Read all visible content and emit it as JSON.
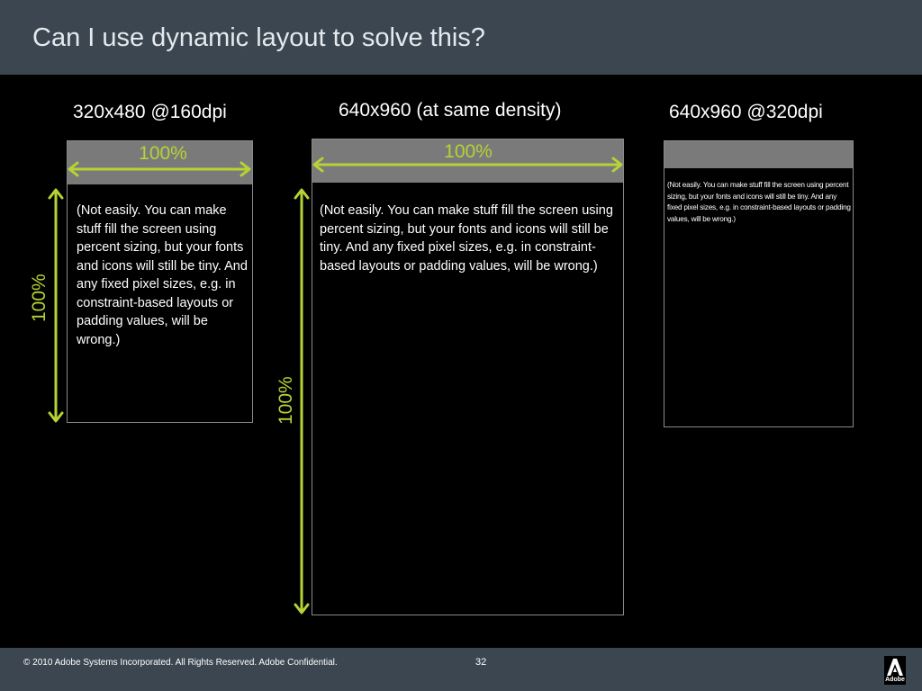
{
  "slide": {
    "title": "Can I use dynamic layout to solve this?",
    "page_number": "32",
    "footer": "© 2010 Adobe Systems Incorporated.  All Rights Reserved.  Adobe Confidential.",
    "logo_text": "Adobe"
  },
  "columns": [
    {
      "label": "320x480 @160dpi",
      "width_label": "100%",
      "height_label": "100%",
      "body": "(Not easily. You can make stuff fill the screen using percent sizing, but your fonts and icons will still be tiny. And any fixed pixel sizes, e.g. in constraint-based layouts or padding values, will be wrong.)"
    },
    {
      "label": "640x960 (at same density)",
      "width_label": "100%",
      "height_label": "100%",
      "body": "(Not easily. You can make stuff fill the screen using percent sizing, but your fonts and icons will still be tiny. And any fixed pixel sizes, e.g. in constraint-based layouts or padding values, will be wrong.)"
    },
    {
      "label": "640x960 @320dpi",
      "body": "(Not easily. You can make stuff fill the screen using percent sizing, but your fonts and icons will still be tiny. And any fixed pixel sizes, e.g. in constraint-based layouts or padding values, will be wrong.)"
    }
  ],
  "colors": {
    "title_bar": "#3b4650",
    "accent": "#b5d334",
    "screen_header": "#7a7a7a"
  }
}
